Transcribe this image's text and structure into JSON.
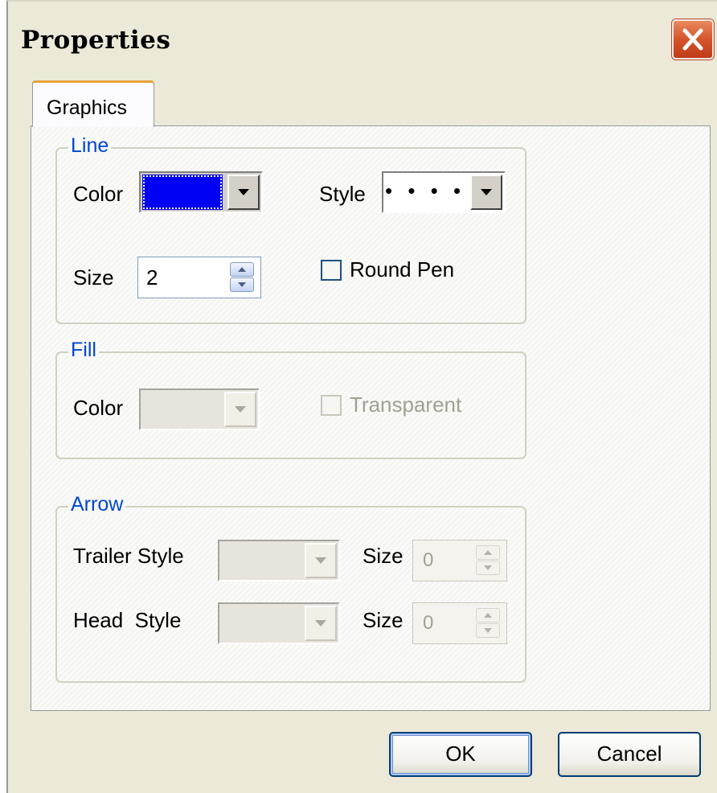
{
  "window": {
    "title": "Properties"
  },
  "tabs": [
    {
      "label": "Graphics",
      "active": true
    }
  ],
  "line_group": {
    "legend": "Line",
    "color_label": "Color",
    "color_value": "#0000f2",
    "style_label": "Style",
    "style_value": "• • • •",
    "size_label": "Size",
    "size_value": "2",
    "round_pen_label": "Round Pen",
    "round_pen_checked": false
  },
  "fill_group": {
    "legend": "Fill",
    "color_label": "Color",
    "transparent_label": "Transparent",
    "transparent_checked": false
  },
  "arrow_group": {
    "legend": "Arrow",
    "trailer_style_label": "Trailer Style",
    "trailer_size_label": "Size",
    "trailer_size_value": "0",
    "head_style_label": "Head  Style",
    "head_size_label": "Size",
    "head_size_value": "0"
  },
  "buttons": {
    "ok": "OK",
    "cancel": "Cancel"
  },
  "icons": {
    "close": "close-icon",
    "dropdown": "chevron-down-icon",
    "spin_up": "spin-up-icon",
    "spin_down": "spin-down-icon"
  }
}
